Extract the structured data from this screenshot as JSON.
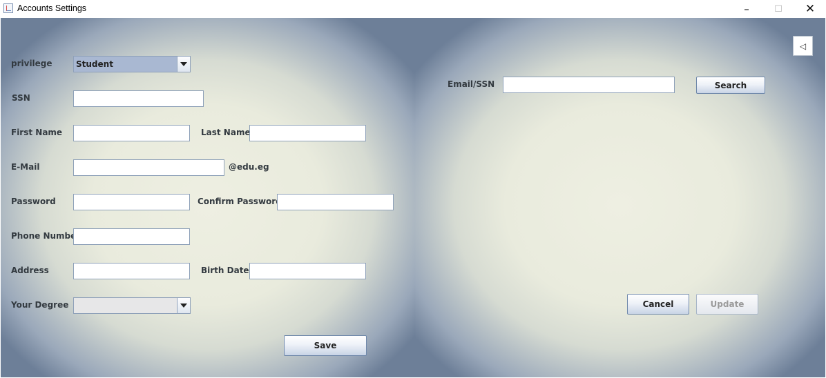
{
  "window": {
    "title": "Accounts Settings",
    "minimize_glyph": "–",
    "maximize_glyph": "☐",
    "close_glyph": "✕"
  },
  "form": {
    "privilege_label": "privilege",
    "privilege_value": "Student",
    "ssn_label": "SSN",
    "first_name_label": "First Name",
    "last_name_label": "Last Name",
    "email_label": "E-Mail",
    "email_suffix": "@edu.eg",
    "password_label": "Password",
    "confirm_password_label": "Confirm Password",
    "phone_label": "Phone Number",
    "address_label": "Address",
    "birth_date_label": "Birth Date",
    "degree_label": "Your Degree",
    "degree_value": "",
    "save_label": "Save"
  },
  "search": {
    "label": "Email/SSN",
    "value": "",
    "button_label": "Search",
    "collapse_glyph": "◁"
  },
  "actions": {
    "cancel_label": "Cancel",
    "update_label": "Update"
  },
  "colors": {
    "privilege_combo_bg": "#a9b8d2",
    "degree_combo_bg": "#e7e7e8",
    "field_border": "#8da0b8"
  }
}
